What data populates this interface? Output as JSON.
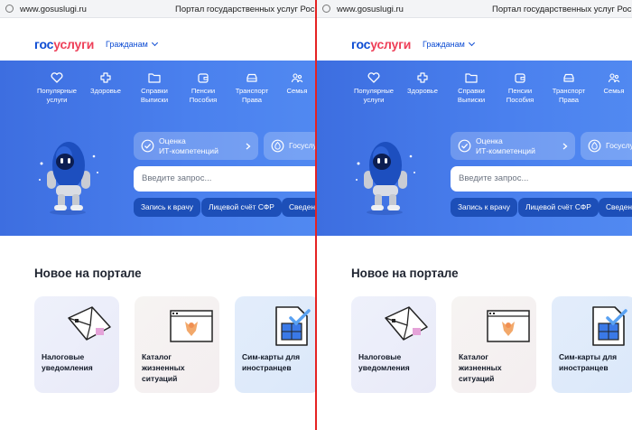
{
  "browser": {
    "url": "www.gosuslugi.ru",
    "page_title": "Портал государственных услуг Российской Федерации"
  },
  "header": {
    "logo_part1": "гос",
    "logo_part2": "услуги",
    "role_selector": "Гражданам"
  },
  "nav": {
    "items": [
      {
        "line1": "Популярные",
        "line2": "услуги",
        "icon": "heart-icon"
      },
      {
        "line1": "Здоровье",
        "line2": "",
        "icon": "plus-icon"
      },
      {
        "line1": "Справки",
        "line2": "Выписки",
        "icon": "folder-icon"
      },
      {
        "line1": "Пенсии",
        "line2": "Пособия",
        "icon": "wallet-icon"
      },
      {
        "line1": "Транспорт",
        "line2": "Права",
        "icon": "car-icon"
      },
      {
        "line1": "Семья",
        "line2": "",
        "icon": "family-icon"
      }
    ]
  },
  "hero": {
    "assessment_line1": "Оценка",
    "assessment_line2": "ИТ-компетенций",
    "gosuslugi_chip": "Госуслуги",
    "search_placeholder": "Введите запрос...",
    "quick_links": [
      "Запись к врачу",
      "Лицевой счёт СФР",
      "Сведения"
    ]
  },
  "news": {
    "title": "Новое на портале",
    "cards": [
      {
        "line1": "Налоговые",
        "line2": "уведомления",
        "line3": ""
      },
      {
        "line1": "Каталог",
        "line2": "жизненных",
        "line3": "ситуаций"
      },
      {
        "line1": "Сим-карты для",
        "line2": "иностранцев",
        "line3": ""
      }
    ]
  },
  "colors": {
    "brand_blue": "#0d4cd3",
    "brand_red": "#ee3f58",
    "hero_blue": "#4a80ee",
    "pill_blue": "#1d4fb8",
    "divider_red": "#e52222"
  }
}
